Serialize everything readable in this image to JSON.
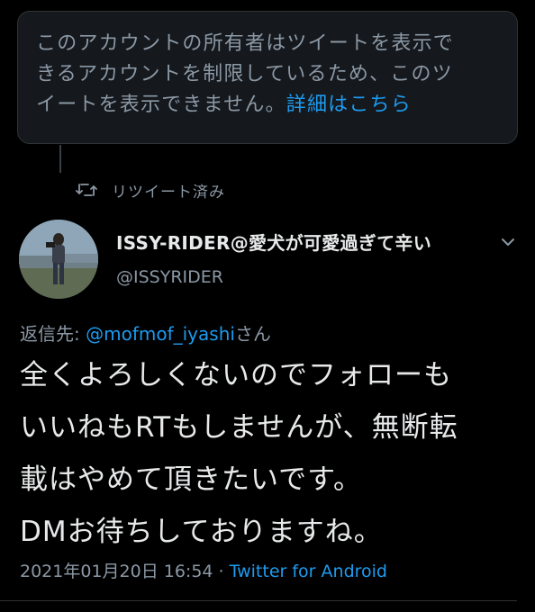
{
  "notice": {
    "line1": "このアカウントの所有者はツイートを表示で",
    "line2": "きるアカウントを制限しているため、このツ",
    "line3": "イートを表示できません。",
    "link": "詳細はこちら"
  },
  "retweet": {
    "label": "リツイート済み",
    "icon": "retweet-icon"
  },
  "author": {
    "display_name": "ISSY-RIDER@愛犬が可愛過ぎて辛い",
    "handle": "@ISSYRIDER"
  },
  "reply": {
    "prefix": "返信先: ",
    "mention": "@mofmof_iyashi",
    "suffix": "さん"
  },
  "tweet": {
    "lines": [
      "全くよろしくないのでフォローも",
      "いいねもRTもしませんが、無断転",
      "載はやめて頂きたいです。",
      "DMお待ちしておりますね。"
    ]
  },
  "meta": {
    "timestamp": "2021年01月20日 16:54",
    "separator": " · ",
    "source": "Twitter for Android"
  },
  "colors": {
    "background": "#000000",
    "accent": "#1d9bf0",
    "muted_text": "#8b98a5",
    "primary_text": "#e7e9ea"
  }
}
